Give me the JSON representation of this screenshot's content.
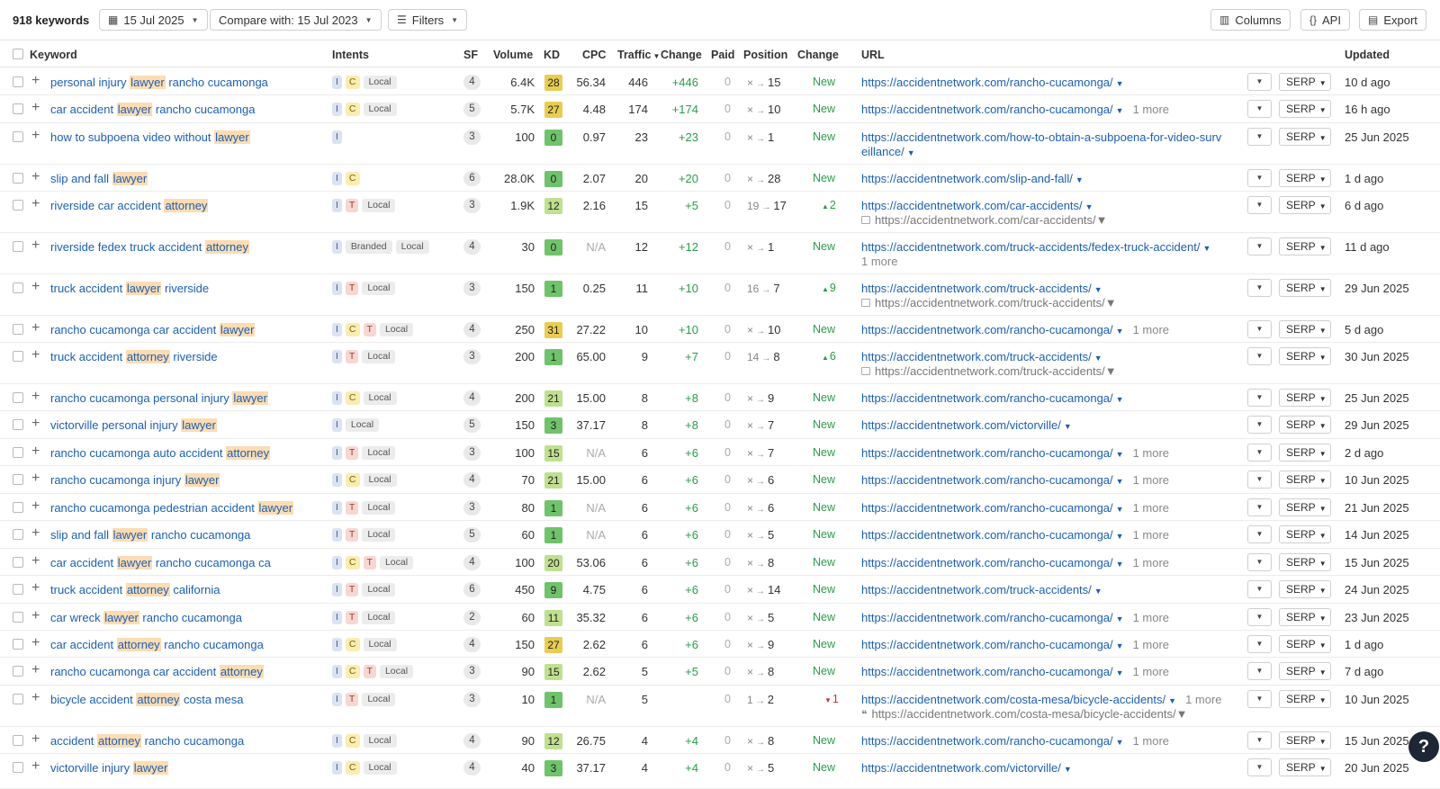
{
  "toolbar": {
    "keyword_count": "918 keywords",
    "date": "15 Jul 2025",
    "compare": "Compare with: 15 Jul 2023",
    "filters": "Filters",
    "columns": "Columns",
    "api": "API",
    "export": "Export"
  },
  "headers": {
    "keyword": "Keyword",
    "intents": "Intents",
    "sf": "SF",
    "volume": "Volume",
    "kd": "KD",
    "cpc": "CPC",
    "traffic": "Traffic",
    "change": "Change",
    "paid": "Paid",
    "position": "Position",
    "pos_change": "Change",
    "url": "URL",
    "updated": "Updated"
  },
  "serp_label": "SERP",
  "help_label": "?",
  "rows": [
    {
      "keyword": [
        "personal injury ",
        "lawyer",
        " rancho cucamonga"
      ],
      "intents": [
        "I",
        "C",
        "Local"
      ],
      "sf": "4",
      "volume": "6.4K",
      "kd": "28",
      "cpc": "56.34",
      "traffic": "446",
      "change": "+446",
      "paid": "0",
      "pos_from": "×",
      "pos_to": "15",
      "pos_change": "New",
      "url": "https://accidentnetwork.com/rancho-cucamonga/",
      "more": "",
      "url2": "",
      "url2_icon": "",
      "updated": "10 d ago"
    },
    {
      "keyword": [
        "car accident ",
        "lawyer",
        " rancho cucamonga"
      ],
      "intents": [
        "I",
        "C",
        "Local"
      ],
      "sf": "5",
      "volume": "5.7K",
      "kd": "27",
      "cpc": "4.48",
      "traffic": "174",
      "change": "+174",
      "paid": "0",
      "pos_from": "×",
      "pos_to": "10",
      "pos_change": "New",
      "url": "https://accidentnetwork.com/rancho-cucamonga/",
      "more": "1 more",
      "url2": "",
      "url2_icon": "",
      "updated": "16 h ago"
    },
    {
      "keyword": [
        "how to subpoena video without ",
        "lawyer",
        ""
      ],
      "intents": [
        "I"
      ],
      "sf": "3",
      "volume": "100",
      "kd": "0",
      "cpc": "0.97",
      "traffic": "23",
      "change": "+23",
      "paid": "0",
      "pos_from": "×",
      "pos_to": "1",
      "pos_change": "New",
      "url": "https://accidentnetwork.com/how-to-obtain-a-subpoena-for-video-surv",
      "url_cont": "eillance/",
      "more": "",
      "url2": "",
      "url2_icon": "",
      "updated": "25 Jun 2025"
    },
    {
      "keyword": [
        "slip and fall ",
        "lawyer",
        ""
      ],
      "intents": [
        "I",
        "C"
      ],
      "sf": "6",
      "volume": "28.0K",
      "kd": "0",
      "cpc": "2.07",
      "traffic": "20",
      "change": "+20",
      "paid": "0",
      "pos_from": "×",
      "pos_to": "28",
      "pos_change": "New",
      "url": "https://accidentnetwork.com/slip-and-fall/",
      "more": "",
      "url2": "",
      "url2_icon": "",
      "updated": "1 d ago"
    },
    {
      "keyword": [
        "riverside car accident ",
        "attorney",
        ""
      ],
      "intents": [
        "I",
        "T",
        "Local"
      ],
      "sf": "3",
      "volume": "1.9K",
      "kd": "12",
      "cpc": "2.16",
      "traffic": "15",
      "change": "+5",
      "paid": "0",
      "pos_from": "19",
      "pos_to": "17",
      "pos_change": "2",
      "pos_dir": "up",
      "url": "https://accidentnetwork.com/car-accidents/",
      "more": "",
      "url2": "https://accidentnetwork.com/car-accidents/",
      "url2_icon": "img",
      "updated": "6 d ago"
    },
    {
      "keyword": [
        "riverside fedex truck accident ",
        "attorney",
        ""
      ],
      "intents": [
        "I",
        "Branded",
        "Local"
      ],
      "sf": "4",
      "volume": "30",
      "kd": "0",
      "cpc": "N/A",
      "traffic": "12",
      "change": "+12",
      "paid": "0",
      "pos_from": "×",
      "pos_to": "1",
      "pos_change": "New",
      "url": "https://accidentnetwork.com/truck-accidents/fedex-truck-accident/",
      "more": "",
      "url_more_below": "1 more",
      "url2": "",
      "url2_icon": "",
      "updated": "11 d ago"
    },
    {
      "keyword": [
        "truck accident ",
        "lawyer",
        " riverside"
      ],
      "intents": [
        "I",
        "T",
        "Local"
      ],
      "sf": "3",
      "volume": "150",
      "kd": "1",
      "cpc": "0.25",
      "traffic": "11",
      "change": "+10",
      "paid": "0",
      "pos_from": "16",
      "pos_to": "7",
      "pos_change": "9",
      "pos_dir": "up",
      "url": "https://accidentnetwork.com/truck-accidents/",
      "more": "",
      "url2": "https://accidentnetwork.com/truck-accidents/",
      "url2_icon": "img",
      "updated": "29 Jun 2025"
    },
    {
      "keyword": [
        "rancho cucamonga car accident ",
        "lawyer",
        ""
      ],
      "intents": [
        "I",
        "C",
        "T",
        "Local"
      ],
      "sf": "4",
      "volume": "250",
      "kd": "31",
      "cpc": "27.22",
      "traffic": "10",
      "change": "+10",
      "paid": "0",
      "pos_from": "×",
      "pos_to": "10",
      "pos_change": "New",
      "url": "https://accidentnetwork.com/rancho-cucamonga/",
      "more": "1 more",
      "url2": "",
      "url2_icon": "",
      "updated": "5 d ago"
    },
    {
      "keyword": [
        "truck accident ",
        "attorney",
        " riverside"
      ],
      "intents": [
        "I",
        "T",
        "Local"
      ],
      "sf": "3",
      "volume": "200",
      "kd": "1",
      "cpc": "65.00",
      "traffic": "9",
      "change": "+7",
      "paid": "0",
      "pos_from": "14",
      "pos_to": "8",
      "pos_change": "6",
      "pos_dir": "up",
      "url": "https://accidentnetwork.com/truck-accidents/",
      "more": "",
      "url2": "https://accidentnetwork.com/truck-accidents/",
      "url2_icon": "img",
      "updated": "30 Jun 2025"
    },
    {
      "keyword": [
        "rancho cucamonga personal injury ",
        "lawyer",
        ""
      ],
      "intents": [
        "I",
        "C",
        "Local"
      ],
      "sf": "4",
      "volume": "200",
      "kd": "21",
      "cpc": "15.00",
      "traffic": "8",
      "change": "+8",
      "paid": "0",
      "pos_from": "×",
      "pos_to": "9",
      "pos_change": "New",
      "url": "https://accidentnetwork.com/rancho-cucamonga/",
      "more": "",
      "url2": "",
      "url2_icon": "",
      "updated": "25 Jun 2025"
    },
    {
      "keyword": [
        "victorville personal injury ",
        "lawyer",
        ""
      ],
      "intents": [
        "I",
        "Local"
      ],
      "sf": "5",
      "volume": "150",
      "kd": "3",
      "cpc": "37.17",
      "traffic": "8",
      "change": "+8",
      "paid": "0",
      "pos_from": "×",
      "pos_to": "7",
      "pos_change": "New",
      "url": "https://accidentnetwork.com/victorville/",
      "more": "",
      "url2": "",
      "url2_icon": "",
      "updated": "29 Jun 2025"
    },
    {
      "keyword": [
        "rancho cucamonga auto accident ",
        "attorney",
        ""
      ],
      "intents": [
        "I",
        "T",
        "Local"
      ],
      "sf": "3",
      "volume": "100",
      "kd": "15",
      "cpc": "N/A",
      "traffic": "6",
      "change": "+6",
      "paid": "0",
      "pos_from": "×",
      "pos_to": "7",
      "pos_change": "New",
      "url": "https://accidentnetwork.com/rancho-cucamonga/",
      "more": "1 more",
      "url2": "",
      "url2_icon": "",
      "updated": "2 d ago"
    },
    {
      "keyword": [
        "rancho cucamonga injury ",
        "lawyer",
        ""
      ],
      "intents": [
        "I",
        "C",
        "Local"
      ],
      "sf": "4",
      "volume": "70",
      "kd": "21",
      "cpc": "15.00",
      "traffic": "6",
      "change": "+6",
      "paid": "0",
      "pos_from": "×",
      "pos_to": "6",
      "pos_change": "New",
      "url": "https://accidentnetwork.com/rancho-cucamonga/",
      "more": "1 more",
      "url2": "",
      "url2_icon": "",
      "updated": "10 Jun 2025"
    },
    {
      "keyword": [
        "rancho cucamonga pedestrian accident ",
        "lawyer",
        ""
      ],
      "intents": [
        "I",
        "T",
        "Local"
      ],
      "sf": "3",
      "volume": "80",
      "kd": "1",
      "cpc": "N/A",
      "traffic": "6",
      "change": "+6",
      "paid": "0",
      "pos_from": "×",
      "pos_to": "6",
      "pos_change": "New",
      "url": "https://accidentnetwork.com/rancho-cucamonga/",
      "more": "1 more",
      "url2": "",
      "url2_icon": "",
      "updated": "21 Jun 2025"
    },
    {
      "keyword": [
        "slip and fall ",
        "lawyer",
        " rancho cucamonga"
      ],
      "intents": [
        "I",
        "T",
        "Local"
      ],
      "sf": "5",
      "volume": "60",
      "kd": "1",
      "cpc": "N/A",
      "traffic": "6",
      "change": "+6",
      "paid": "0",
      "pos_from": "×",
      "pos_to": "5",
      "pos_change": "New",
      "url": "https://accidentnetwork.com/rancho-cucamonga/",
      "more": "1 more",
      "url2": "",
      "url2_icon": "",
      "updated": "14 Jun 2025"
    },
    {
      "keyword": [
        "car accident ",
        "lawyer",
        " rancho cucamonga ca"
      ],
      "intents": [
        "I",
        "C",
        "T",
        "Local"
      ],
      "sf": "4",
      "volume": "100",
      "kd": "20",
      "cpc": "53.06",
      "traffic": "6",
      "change": "+6",
      "paid": "0",
      "pos_from": "×",
      "pos_to": "8",
      "pos_change": "New",
      "url": "https://accidentnetwork.com/rancho-cucamonga/",
      "more": "1 more",
      "url2": "",
      "url2_icon": "",
      "updated": "15 Jun 2025"
    },
    {
      "keyword": [
        "truck accident ",
        "attorney",
        " california"
      ],
      "intents": [
        "I",
        "T",
        "Local"
      ],
      "sf": "6",
      "volume": "450",
      "kd": "9",
      "cpc": "4.75",
      "traffic": "6",
      "change": "+6",
      "paid": "0",
      "pos_from": "×",
      "pos_to": "14",
      "pos_change": "New",
      "url": "https://accidentnetwork.com/truck-accidents/",
      "more": "",
      "url2": "",
      "url2_icon": "",
      "updated": "24 Jun 2025"
    },
    {
      "keyword": [
        "car wreck ",
        "lawyer",
        " rancho cucamonga"
      ],
      "intents": [
        "I",
        "T",
        "Local"
      ],
      "sf": "2",
      "volume": "60",
      "kd": "11",
      "cpc": "35.32",
      "traffic": "6",
      "change": "+6",
      "paid": "0",
      "pos_from": "×",
      "pos_to": "5",
      "pos_change": "New",
      "url": "https://accidentnetwork.com/rancho-cucamonga/",
      "more": "1 more",
      "url2": "",
      "url2_icon": "",
      "updated": "23 Jun 2025"
    },
    {
      "keyword": [
        "car accident ",
        "attorney",
        " rancho cucamonga"
      ],
      "intents": [
        "I",
        "C",
        "Local"
      ],
      "sf": "4",
      "volume": "150",
      "kd": "27",
      "cpc": "2.62",
      "traffic": "6",
      "change": "+6",
      "paid": "0",
      "pos_from": "×",
      "pos_to": "9",
      "pos_change": "New",
      "url": "https://accidentnetwork.com/rancho-cucamonga/",
      "more": "1 more",
      "url2": "",
      "url2_icon": "",
      "updated": "1 d ago"
    },
    {
      "keyword": [
        "rancho cucamonga car accident ",
        "attorney",
        ""
      ],
      "intents": [
        "I",
        "C",
        "T",
        "Local"
      ],
      "sf": "3",
      "volume": "90",
      "kd": "15",
      "cpc": "2.62",
      "traffic": "5",
      "change": "+5",
      "paid": "0",
      "pos_from": "×",
      "pos_to": "8",
      "pos_change": "New",
      "url": "https://accidentnetwork.com/rancho-cucamonga/",
      "more": "1 more",
      "url2": "",
      "url2_icon": "",
      "updated": "7 d ago"
    },
    {
      "keyword": [
        "bicycle accident ",
        "attorney",
        " costa mesa"
      ],
      "intents": [
        "I",
        "T",
        "Local"
      ],
      "sf": "3",
      "volume": "10",
      "kd": "1",
      "cpc": "N/A",
      "traffic": "5",
      "change": "",
      "paid": "0",
      "pos_from": "1",
      "pos_to": "2",
      "pos_change": "1",
      "pos_dir": "down",
      "url": "https://accidentnetwork.com/costa-mesa/bicycle-accidents/",
      "more": "1 more",
      "url2": "https://accidentnetwork.com/costa-mesa/bicycle-accidents/",
      "url2_icon": "quote",
      "updated": "10 Jun 2025"
    },
    {
      "keyword": [
        "accident ",
        "attorney",
        " rancho cucamonga"
      ],
      "intents": [
        "I",
        "C",
        "Local"
      ],
      "sf": "4",
      "volume": "90",
      "kd": "12",
      "cpc": "26.75",
      "traffic": "4",
      "change": "+4",
      "paid": "0",
      "pos_from": "×",
      "pos_to": "8",
      "pos_change": "New",
      "url": "https://accidentnetwork.com/rancho-cucamonga/",
      "more": "1 more",
      "url2": "",
      "url2_icon": "",
      "updated": "15 Jun 2025"
    },
    {
      "keyword": [
        "victorville injury ",
        "lawyer",
        ""
      ],
      "intents": [
        "I",
        "C",
        "Local"
      ],
      "sf": "4",
      "volume": "40",
      "kd": "3",
      "cpc": "37.17",
      "traffic": "4",
      "change": "+4",
      "paid": "0",
      "pos_from": "×",
      "pos_to": "5",
      "pos_change": "New",
      "url": "https://accidentnetwork.com/victorville/",
      "more": "",
      "url2": "",
      "url2_icon": "",
      "updated": "20 Jun 2025"
    }
  ]
}
